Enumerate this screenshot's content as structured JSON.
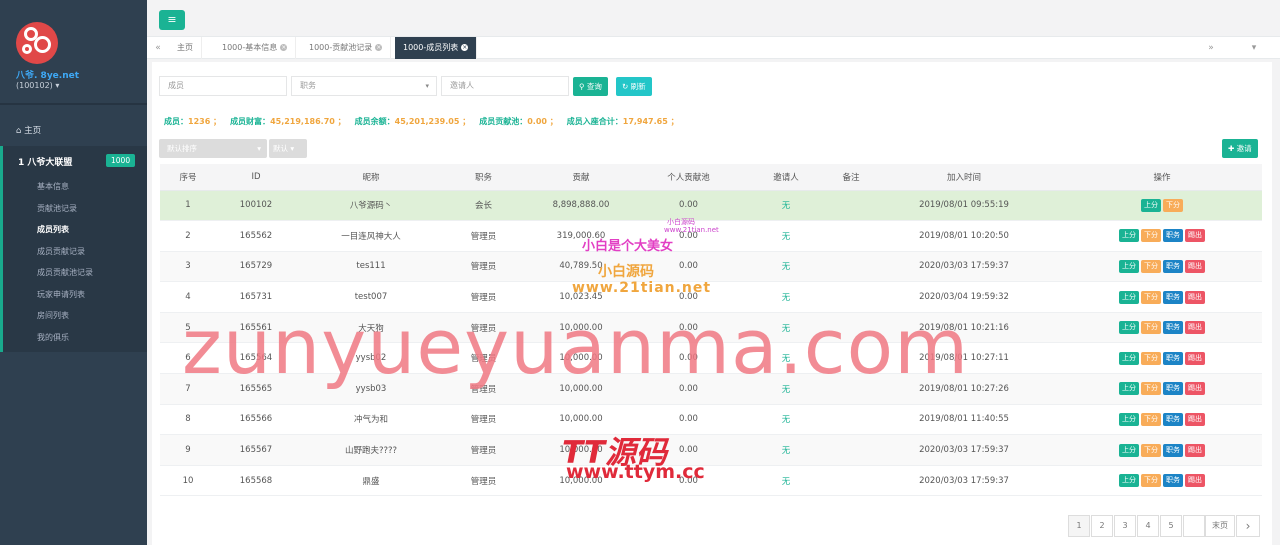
{
  "sidebar": {
    "brand": "八爷. 8ye.net",
    "user_id": "(100102) ▾",
    "home": "主页",
    "group_title": "1  八爷大联盟",
    "group_badge": "1000",
    "items": [
      {
        "label": "基本信息",
        "active": false
      },
      {
        "label": "贡献池记录",
        "active": false
      },
      {
        "label": "成员列表",
        "active": true
      },
      {
        "label": "成员贡献记录",
        "active": false
      },
      {
        "label": "成员贡献池记录",
        "active": false
      },
      {
        "label": "玩家申请列表",
        "active": false
      },
      {
        "label": "房间列表",
        "active": false
      },
      {
        "label": "我的俱乐",
        "active": false
      }
    ]
  },
  "tabs": [
    {
      "label": "主页",
      "close": false
    },
    {
      "label": "1000-基本信息",
      "close": true
    },
    {
      "label": "1000-贡献池记录",
      "close": true
    },
    {
      "label": "1000-成员列表",
      "close": true,
      "active": true
    }
  ],
  "filters": {
    "member_placeholder": "成员",
    "role_placeholder": "职务",
    "inviter_placeholder": "邀请人",
    "query_label": "查询",
    "refresh_label": "刷新"
  },
  "stats": [
    {
      "label": "成员：",
      "value": "1236 ；"
    },
    {
      "label": "成员财富：",
      "value": "45,219,186.70 ；"
    },
    {
      "label": "成员余额：",
      "value": "45,201,239.05 ；"
    },
    {
      "label": "成员贡献池：",
      "value": "0.00 ；"
    },
    {
      "label": "成员入座合计：",
      "value": "17,947.65 ；"
    }
  ],
  "sort": {
    "default_sort": "默认排序",
    "default": "默认"
  },
  "add_label": "邀请",
  "table": {
    "headers": [
      "序号",
      "ID",
      "昵称",
      "职务",
      "贡献",
      "个人贡献池",
      "邀请人",
      "备注",
      "加入时间",
      "操作"
    ],
    "actions": {
      "up": "上分",
      "down": "下分",
      "job": "职务",
      "kick": "踢出"
    },
    "rows": [
      {
        "no": "1",
        "id": "100102",
        "nick": "八爷源码丶",
        "role": "会长",
        "contrib": "8,898,888.00",
        "pool": "0.00",
        "inviter": "无",
        "note": "",
        "time": "2019/08/01 09:55:19"
      },
      {
        "no": "2",
        "id": "165562",
        "nick": "一目连风神大人",
        "role": "管理员",
        "contrib": "319,000.60",
        "pool": "0.00",
        "inviter": "无",
        "note": "",
        "time": "2019/08/01 10:20:50"
      },
      {
        "no": "3",
        "id": "165729",
        "nick": "tes111",
        "role": "管理员",
        "contrib": "40,789.50",
        "pool": "0.00",
        "inviter": "无",
        "note": "",
        "time": "2020/03/03 17:59:37"
      },
      {
        "no": "4",
        "id": "165731",
        "nick": "test007",
        "role": "管理员",
        "contrib": "10,023.45",
        "pool": "0.00",
        "inviter": "无",
        "note": "",
        "time": "2020/03/04 19:59:32"
      },
      {
        "no": "5",
        "id": "165561",
        "nick": "大天狗",
        "role": "管理员",
        "contrib": "10,000.00",
        "pool": "0.00",
        "inviter": "无",
        "note": "",
        "time": "2019/08/01 10:21:16"
      },
      {
        "no": "6",
        "id": "165564",
        "nick": "yysb02",
        "role": "管理员",
        "contrib": "10,000.00",
        "pool": "0.00",
        "inviter": "无",
        "note": "",
        "time": "2019/08/01 10:27:11"
      },
      {
        "no": "7",
        "id": "165565",
        "nick": "yysb03",
        "role": "管理员",
        "contrib": "10,000.00",
        "pool": "0.00",
        "inviter": "无",
        "note": "",
        "time": "2019/08/01 10:27:26"
      },
      {
        "no": "8",
        "id": "165566",
        "nick": "冲气为和",
        "role": "管理员",
        "contrib": "10,000.00",
        "pool": "0.00",
        "inviter": "无",
        "note": "",
        "time": "2019/08/01 11:40:55"
      },
      {
        "no": "9",
        "id": "165567",
        "nick": "山野跑夫????",
        "role": "管理员",
        "contrib": "10,000.00",
        "pool": "0.00",
        "inviter": "无",
        "note": "",
        "time": "2020/03/03 17:59:37"
      },
      {
        "no": "10",
        "id": "165568",
        "nick": "鼎盛",
        "role": "管理员",
        "contrib": "10,000.00",
        "pool": "0.00",
        "inviter": "无",
        "note": "",
        "time": "2020/03/03 17:59:37"
      }
    ]
  },
  "pagination": {
    "pages": [
      "1",
      "2",
      "3",
      "4",
      "5"
    ],
    "last": "末页",
    "next": "›"
  },
  "watermarks": {
    "main": "zunyueyuanma.com",
    "tt": "TT源码",
    "ttym": "www.ttym.cc",
    "xb1": "小白是个大美女",
    "xb2": "小白源码",
    "xb3": "www.21tian.net",
    "s1": "小白源码",
    "s2": "www.21tian.net"
  },
  "colors": {
    "sidebar": "#2f4050",
    "accent": "#1ab394",
    "warning": "#f8ac59",
    "info": "#1c84c6",
    "danger": "#ed5565",
    "highlight_row": "#dff0d8"
  }
}
